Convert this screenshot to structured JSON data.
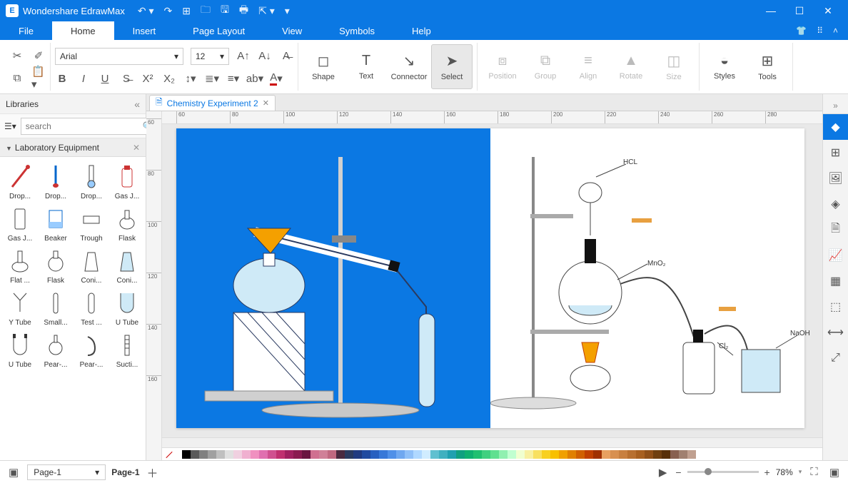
{
  "app": {
    "name": "Wondershare EdrawMax"
  },
  "qat": [
    "undo",
    "redo",
    "new",
    "open",
    "save",
    "print",
    "export",
    "more"
  ],
  "menus": [
    "File",
    "Home",
    "Insert",
    "Page Layout",
    "View",
    "Symbols",
    "Help"
  ],
  "active_menu": "Home",
  "font": {
    "family": "Arial",
    "size": "12"
  },
  "ribbon_big": {
    "shape": "Shape",
    "text": "Text",
    "connector": "Connector",
    "select": "Select",
    "position": "Position",
    "group": "Group",
    "align": "Align",
    "rotate": "Rotate",
    "size": "Size",
    "styles": "Styles",
    "tools": "Tools"
  },
  "libraries": {
    "title": "Libraries",
    "search_placeholder": "search",
    "category": "Laboratory Equipment",
    "items": [
      {
        "label": "Drop..."
      },
      {
        "label": "Drop..."
      },
      {
        "label": "Drop..."
      },
      {
        "label": "Gas J..."
      },
      {
        "label": "Gas J..."
      },
      {
        "label": "Beaker"
      },
      {
        "label": "Trough"
      },
      {
        "label": "Flask"
      },
      {
        "label": "Flat ..."
      },
      {
        "label": "Flask"
      },
      {
        "label": "Coni..."
      },
      {
        "label": "Coni..."
      },
      {
        "label": "Y Tube"
      },
      {
        "label": "Small..."
      },
      {
        "label": "Test ..."
      },
      {
        "label": "U Tube"
      },
      {
        "label": "U Tube"
      },
      {
        "label": "Pear-..."
      },
      {
        "label": "Pear-..."
      },
      {
        "label": "Sucti..."
      }
    ]
  },
  "doc_tab": "Chemistry Experiment 2",
  "hruler_ticks": [
    "60",
    "80",
    "100",
    "120",
    "140",
    "160",
    "180",
    "200",
    "220",
    "240",
    "260",
    "280"
  ],
  "vruler_ticks": [
    "60",
    "80",
    "100",
    "120",
    "140",
    "160"
  ],
  "chem_labels": {
    "hcl": "HCL",
    "mno2": "MnO₂",
    "naoh": "NaOH",
    "cl2": "Cl₂"
  },
  "swatches": [
    "#ffffff",
    "#000000",
    "#5a5a5a",
    "#808080",
    "#a0a0a0",
    "#c0c0c0",
    "#e0e0e0",
    "#f0d0e0",
    "#f0b0d0",
    "#f090c0",
    "#e070b0",
    "#d05090",
    "#c03070",
    "#a02060",
    "#8a1a50",
    "#6a1440",
    "#d07090",
    "#d08098",
    "#c06880",
    "#4a2a40",
    "#2a3a60",
    "#203a80",
    "#204aa0",
    "#2860c0",
    "#3878d8",
    "#5090e8",
    "#70a8f0",
    "#90c0f8",
    "#b0d8ff",
    "#d0ecff",
    "#60c0d0",
    "#40b0c0",
    "#20a0b0",
    "#10a080",
    "#10b070",
    "#20c070",
    "#40d080",
    "#60e090",
    "#90f0b0",
    "#c0ffd0",
    "#f0ffd0",
    "#f8f0a0",
    "#f8e060",
    "#f8d020",
    "#f8c000",
    "#f0a000",
    "#e08000",
    "#d06000",
    "#c04000",
    "#a03000",
    "#e8a060",
    "#d89050",
    "#c88040",
    "#b87030",
    "#a86020",
    "#905018",
    "#704010",
    "#583008",
    "#886050",
    "#a08070",
    "#c0a090"
  ],
  "status": {
    "page_sel": "Page-1",
    "page_lab": "Page-1",
    "zoom": "78%"
  },
  "right_icons": [
    "theme",
    "grid",
    "image",
    "layers",
    "page",
    "chart",
    "table",
    "symbols",
    "focus",
    "fullscreen"
  ]
}
